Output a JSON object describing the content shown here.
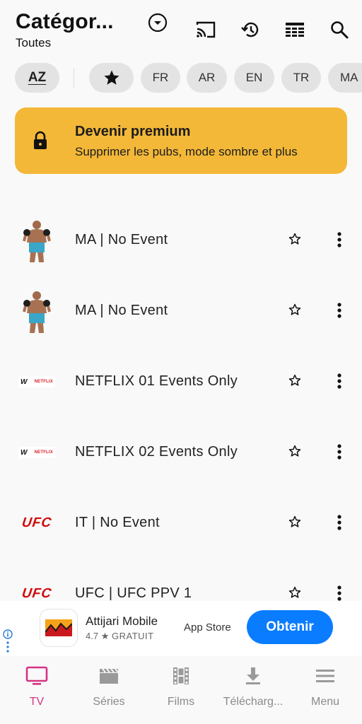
{
  "header": {
    "title": "Catégor...",
    "subtitle": "Toutes"
  },
  "filters": {
    "sort_label": "AZ",
    "favorites_icon": "star-icon",
    "languages": [
      "FR",
      "AR",
      "EN",
      "TR",
      "MA"
    ]
  },
  "premium": {
    "title": "Devenir premium",
    "subtitle": "Supprimer les pubs, mode sombre et plus",
    "color": "#f3b838"
  },
  "channels": [
    {
      "name": "MA | No Event",
      "logo": "fighter"
    },
    {
      "name": "MA | No Event",
      "logo": "fighter"
    },
    {
      "name": "NETFLIX 01 Events Only",
      "logo": "wwe-netflix"
    },
    {
      "name": "NETFLIX 02 Events Only",
      "logo": "wwe-netflix"
    },
    {
      "name": "IT | No Event",
      "logo": "ufc"
    },
    {
      "name": "UFC | UFC PPV 1",
      "logo": "ufc"
    }
  ],
  "logos": {
    "wwe": "W",
    "netflix": "NETFLIX",
    "ufc": "UFC"
  },
  "ad": {
    "app_name": "Attijari Mobile",
    "rating": "4.7",
    "price": "GRATUIT",
    "store": "App Store",
    "cta": "Obtenir",
    "cta_color": "#0a7cff"
  },
  "nav": {
    "items": [
      {
        "label": "TV",
        "icon": "tv-icon",
        "active": true
      },
      {
        "label": "Séries",
        "icon": "clapper-icon",
        "active": false
      },
      {
        "label": "Films",
        "icon": "film-strip-icon",
        "active": false
      },
      {
        "label": "Télécharg...",
        "icon": "download-icon",
        "active": false
      },
      {
        "label": "Menu",
        "icon": "menu-icon",
        "active": false
      }
    ],
    "active_color": "#d63384"
  }
}
